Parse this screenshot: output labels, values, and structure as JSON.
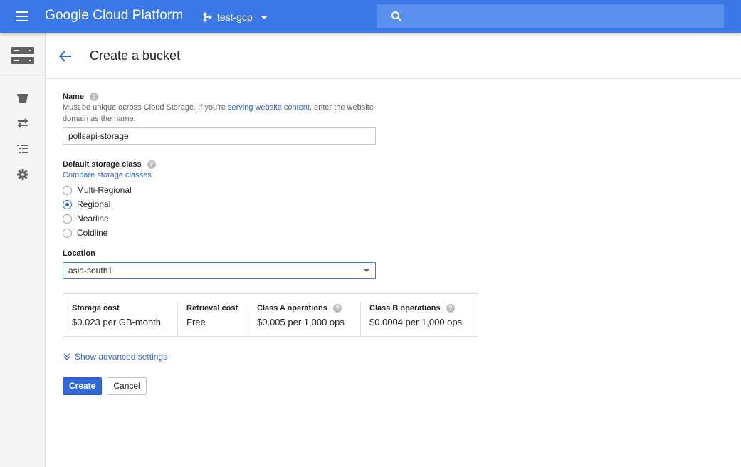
{
  "topbar": {
    "brand": "Google Cloud Platform",
    "project_name": "test-gcp",
    "search_placeholder": ""
  },
  "header": {
    "title": "Create a bucket"
  },
  "name_field": {
    "label": "Name",
    "hint_before": "Must be unique across Cloud Storage. If you're ",
    "hint_link": "serving website content",
    "hint_after": ", enter the website domain as the name.",
    "value": "pollsapi-storage"
  },
  "storage_class": {
    "label": "Default storage class",
    "compare_link": "Compare storage classes",
    "options": [
      "Multi-Regional",
      "Regional",
      "Nearline",
      "Coldline"
    ],
    "selected": "Regional"
  },
  "location": {
    "label": "Location",
    "value": "asia-south1"
  },
  "costs": [
    {
      "label": "Storage cost",
      "value": "$0.023 per GB-month",
      "help": false
    },
    {
      "label": "Retrieval cost",
      "value": "Free",
      "help": false
    },
    {
      "label": "Class A operations",
      "value": "$0.005 per 1,000 ops",
      "help": true
    },
    {
      "label": "Class B operations",
      "value": "$0.0004 per 1,000 ops",
      "help": true
    }
  ],
  "advanced_link": "Show advanced settings",
  "buttons": {
    "create": "Create",
    "cancel": "Cancel"
  },
  "colors": {
    "topbar": "#3b78e7",
    "primary": "#3367d6",
    "link": "#3367d6"
  },
  "icons": {
    "menu": "hamburger-menu-icon",
    "project": "project-hierarchy-icon",
    "search": "search-icon",
    "product": "storage-icon",
    "back": "arrow-back-icon",
    "rail": [
      "bucket-icon",
      "transfer-icon",
      "list-icon",
      "gear-icon"
    ],
    "help": "help-icon",
    "expand": "chevron-down-icon"
  }
}
